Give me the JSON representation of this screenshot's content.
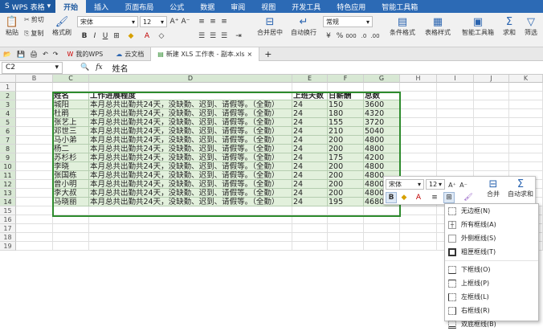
{
  "app": {
    "name": "WPS 表格"
  },
  "menu_tabs": [
    "开始",
    "插入",
    "页面布局",
    "公式",
    "数据",
    "审阅",
    "视图",
    "开发工具",
    "特色应用",
    "智能工具箱"
  ],
  "ribbon": {
    "paste": "粘贴",
    "cut": "剪切",
    "copy": "复制",
    "format_painter": "格式刷",
    "font_name": "宋体",
    "font_size": "12",
    "merge_center": "合并居中",
    "wrap_text": "自动换行",
    "number_format": "常规",
    "conditional_format": "条件格式",
    "table_style": "表格样式",
    "smart_toolbox": "智能工具箱",
    "sum": "求和",
    "filter": "筛选"
  },
  "doc_tabs": [
    "我的WPS",
    "云文档",
    "新建 XLS 工作表 - 副本.xls"
  ],
  "formula_bar": {
    "cell_ref": "C2",
    "fx": "fx",
    "content": "姓名"
  },
  "columns": [
    "B",
    "C",
    "D",
    "E",
    "F",
    "G",
    "H",
    "I",
    "J",
    "K"
  ],
  "rows": [
    "1",
    "2",
    "3",
    "4",
    "5",
    "6",
    "7",
    "8",
    "9",
    "10",
    "11",
    "12",
    "13",
    "14",
    "15",
    "16",
    "17",
    "18",
    "19"
  ],
  "table": {
    "headers": [
      "姓名",
      "工作进展程度",
      "上班天数",
      "日薪酬",
      "总数"
    ],
    "rows": [
      [
        "城阳",
        "本月总共出勤共24天，没缺勤、迟到、请假等。（全勤）",
        "24",
        "150",
        "3600"
      ],
      [
        "杜鹃",
        "本月总共出勤共24天，没缺勤、迟到、请假等。（全勤）",
        "24",
        "180",
        "4320"
      ],
      [
        "张艺上",
        "本月总共出勤共24天，没缺勤、迟到、请假等。（全勤）",
        "24",
        "155",
        "3720"
      ],
      [
        "邓世三",
        "本月总共出勤共24天，没缺勤、迟到、请假等。（全勤）",
        "24",
        "210",
        "5040"
      ],
      [
        "马小弟",
        "本月总共出勤共24天，没缺勤、迟到、请假等。（全勤）",
        "24",
        "200",
        "4800"
      ],
      [
        "杨二",
        "本月总共出勤共24天，没缺勤、迟到、请假等。（全勤）",
        "24",
        "200",
        "4800"
      ],
      [
        "苏杉杉",
        "本月总共出勤共24天，没缺勤、迟到、请假等。（全勤）",
        "24",
        "175",
        "4200"
      ],
      [
        "李晓",
        "本月总共出勤共24天，没缺勤、迟到、请假等。（全勤）",
        "24",
        "200",
        "4800"
      ],
      [
        "张国栋",
        "本月总共出勤共24天，没缺勤、迟到、请假等。（全勤）",
        "24",
        "200",
        "4800"
      ],
      [
        "曾小明",
        "本月总共出勤共24天，没缺勤、迟到、请假等。（全勤）",
        "24",
        "200",
        "4800"
      ],
      [
        "李大叔",
        "本月总共出勤共24天，没缺勤、迟到、请假等。（全勤）",
        "24",
        "200",
        "4800"
      ],
      [
        "马晓丽",
        "本月总共出勤共24天，没缺勤、迟到、请假等。（全勤）",
        "24",
        "195",
        "4680"
      ]
    ]
  },
  "mini_toolbar": {
    "font_name": "宋体",
    "font_size": "12",
    "merge_label": "合并",
    "autosum_label": "自动求和"
  },
  "border_menu": [
    "无边框(N)",
    "所有框线(A)",
    "外侧框线(S)",
    "粗匣框线(T)",
    "下框线(O)",
    "上框线(P)",
    "左框线(L)",
    "右框线(R)",
    "双底框线(B)"
  ]
}
